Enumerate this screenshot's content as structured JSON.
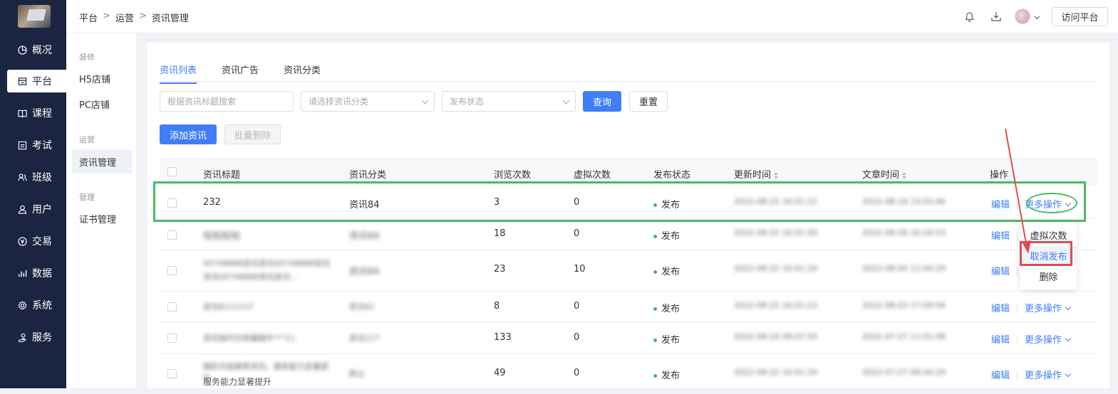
{
  "sidebar": {
    "items": [
      {
        "label": "概况",
        "icon": "pie-chart-icon"
      },
      {
        "label": "平台",
        "icon": "store-icon"
      },
      {
        "label": "课程",
        "icon": "book-icon"
      },
      {
        "label": "考试",
        "icon": "exam-icon"
      },
      {
        "label": "班级",
        "icon": "class-icon"
      },
      {
        "label": "用户",
        "icon": "user-icon"
      },
      {
        "label": "交易",
        "icon": "trade-icon"
      },
      {
        "label": "数据",
        "icon": "bar-chart-icon"
      },
      {
        "label": "系统",
        "icon": "gear-icon"
      },
      {
        "label": "服务",
        "icon": "service-icon"
      }
    ],
    "active": "平台"
  },
  "subnav": {
    "group_decor": "装修",
    "h5": "H5店铺",
    "pc": "PC店铺",
    "group_ops": "运营",
    "news": "资讯管理",
    "group_manage": "管理",
    "cert": "证书管理"
  },
  "breadcrumb": {
    "items": [
      "平台",
      "运营",
      "资讯管理"
    ],
    "separator": ">"
  },
  "header": {
    "visit_label": "访问平台"
  },
  "tabs": [
    {
      "label": "资讯列表",
      "active": true
    },
    {
      "label": "资讯广告",
      "active": false
    },
    {
      "label": "资讯分类",
      "active": false
    }
  ],
  "filters": {
    "search_placeholder": "根据资讯标题搜索",
    "category_placeholder": "请选择资讯分类",
    "status_placeholder": "发布状态",
    "query_label": "查询",
    "reset_label": "重置"
  },
  "actions": {
    "add_label": "添加资讯",
    "batch_delete_label": "批量删除"
  },
  "table": {
    "columns": [
      "资讯标题",
      "资讯分类",
      "浏览次数",
      "虚拟次数",
      "发布状态",
      "更新时间",
      "文章时间",
      "操作"
    ],
    "rows": [
      {
        "title": "232",
        "category": "资讯84",
        "views": "3",
        "virtual": "0",
        "status": "发布",
        "updated": "2022-08-22 16:01:22",
        "article_time": "2022-08-18 14:03:46",
        "edit": "编辑",
        "more": "更多操作"
      },
      {
        "title": "啦啦啦啦",
        "category": "资讯84",
        "views": "18",
        "virtual": "0",
        "status": "发布",
        "updated": "2022-08-22 16:01:09",
        "article_time": "2022-08-09 16:26:53",
        "edit": "编辑",
        "more": "更多操作"
      },
      {
        "title": "00748888资讯资讯00748888资讯资讯00748888资讯资讯...",
        "category": "资讯84",
        "views": "23",
        "virtual": "10",
        "status": "发布",
        "updated": "2022-08-22 16:01:24",
        "article_time": "2022-08-04 11:44:29",
        "edit": "编辑",
        "more": "更多操作"
      },
      {
        "title": "资讯6111157",
        "category": "资讯61",
        "views": "8",
        "virtual": "0",
        "status": "发布",
        "updated": "2022-08-22 16:01:23",
        "article_time": "2022-08-03 17:09:56",
        "edit": "编辑",
        "more": "更多操作"
      },
      {
        "title": "资讯操作示例编辑中***11",
        "category": "资讯117",
        "views": "133",
        "virtual": "0",
        "status": "发布",
        "updated": "2022-08-24 09:07:50",
        "article_time": "2022-07-27 11:01:08",
        "edit": "编辑",
        "more": "更多操作"
      },
      {
        "title": "精彩内容推荐资讯，服务能力显著提升",
        "category": "默认",
        "views": "49",
        "virtual": "0",
        "status": "发布",
        "updated": "2022-08-22 16:01:24",
        "article_time": "2022-07-27 09:26:29",
        "edit": "编辑",
        "more": "更多操作"
      }
    ],
    "row6_tail": "服务能力显著提升"
  },
  "dropdown": {
    "items": [
      "虚拟次数",
      "取消发布",
      "删除"
    ],
    "highlighted": "取消发布"
  },
  "colors": {
    "primary": "#3f7ef6",
    "sidebar": "#1b2541",
    "highlight_green": "#4cbb63",
    "highlight_red": "#e14b52",
    "status_dot": "#4caf7d"
  }
}
